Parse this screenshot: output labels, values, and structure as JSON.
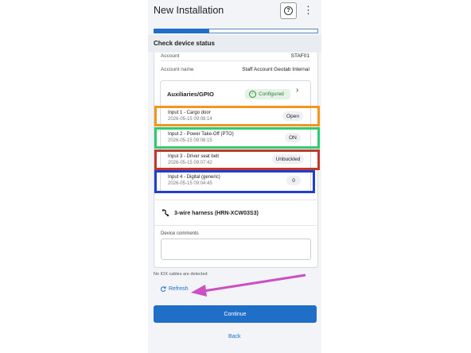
{
  "app": {
    "title": "New Installation",
    "help_icon": "?",
    "menu_icon": "⋮"
  },
  "progress": {
    "fraction": 0.34
  },
  "step": {
    "title": "Check device status"
  },
  "account": {
    "partial_label": "Account",
    "partial_value": "STAF01",
    "name_label": "Account name",
    "name_value": "Staff Account Geotab Internal"
  },
  "aux": {
    "title": "Auxiliaries/GPIO",
    "badge": "Configured",
    "inputs": [
      {
        "name": "Input 1 - Cargo door",
        "time": "2026-05-15 09:08:14",
        "state": "Open"
      },
      {
        "name": "Input 2 - Power Take-Off (PTO)",
        "time": "2026-05-15 09:08:15",
        "state": "ON"
      },
      {
        "name": "Input 3 - Driver seat belt",
        "time": "2026-05-15 09:07:42",
        "state": "Unbuckled"
      },
      {
        "name": "Input 4 - Digital (generic)",
        "time": "2026-05-15 09:04:45",
        "state": "0"
      }
    ]
  },
  "harness": {
    "label": "3-wire harness (HRN-XCW03S3)"
  },
  "comments": {
    "label": "Device comments",
    "value": ""
  },
  "iox_note": "No IOX cables are detected",
  "refresh_label": "Refresh",
  "continue_label": "Continue",
  "back_label": "Back",
  "highlight_colors": {
    "input1": "#f7941d",
    "input2": "#2ecc71",
    "input3": "#c0392b",
    "input4": "#1f3fd1",
    "arrow": "#cc4fc4"
  }
}
